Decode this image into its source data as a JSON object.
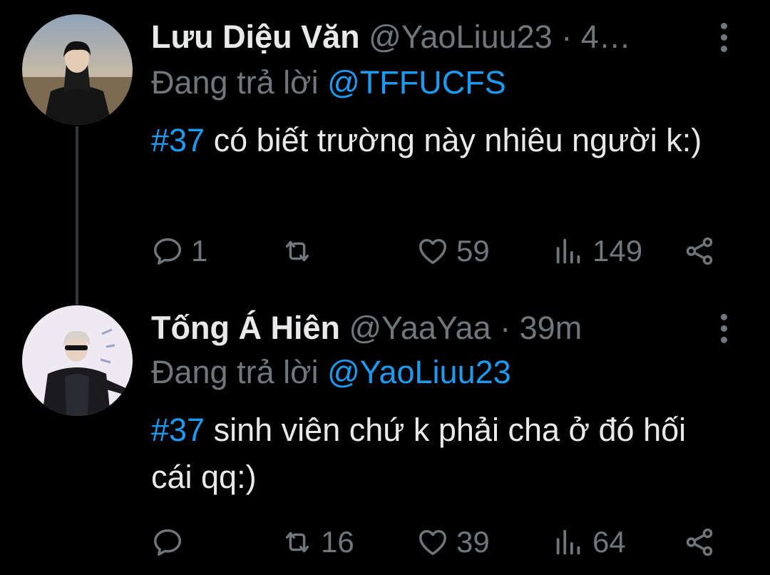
{
  "colors": {
    "background": "#000000",
    "text": "#e7e9ea",
    "muted": "#71767b",
    "accent": "#1d9bf0",
    "thread_line": "#333639"
  },
  "tweets": [
    {
      "author_name": "Lưu Diệu Văn",
      "handle": "@YaoLiuu23",
      "separator": "·",
      "time": "4…",
      "replying_label": "Đang trả lời",
      "replying_to": "@TFFUCFS",
      "hashtag": "#37",
      "text": "có biết trường này nhiêu người k:)",
      "actions": {
        "reply_count": "1",
        "retweet_count": "",
        "like_count": "59",
        "views_count": "149"
      },
      "icons": [
        "avatar",
        "more-vertical-icon",
        "reply-icon",
        "retweet-icon",
        "heart-icon",
        "views-icon",
        "share-icon"
      ]
    },
    {
      "author_name": "Tống Á Hiên",
      "handle": "@YaaYaa",
      "separator": "·",
      "time": "39m",
      "replying_label": "Đang trả lời",
      "replying_to": "@YaoLiuu23",
      "hashtag": "#37",
      "text": "sinh viên chứ k phải cha ở đó hối cái qq:)",
      "actions": {
        "reply_count": "",
        "retweet_count": "16",
        "like_count": "39",
        "views_count": "64"
      },
      "icons": [
        "avatar",
        "more-vertical-icon",
        "reply-icon",
        "retweet-icon",
        "heart-icon",
        "views-icon",
        "share-icon"
      ]
    }
  ]
}
